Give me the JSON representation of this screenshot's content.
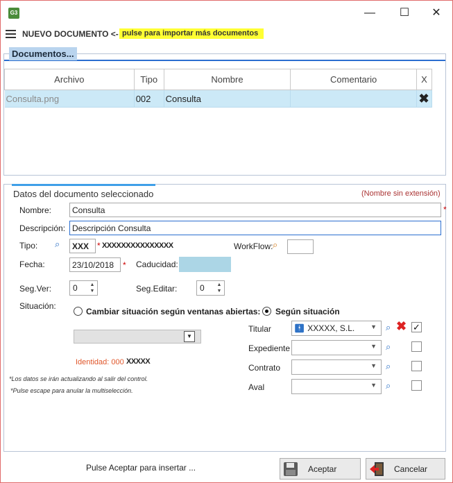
{
  "window": {
    "app_icon": "G3",
    "minimize_glyph": "—",
    "maximize_glyph": "☐",
    "close_glyph": "✕"
  },
  "header": {
    "title": "NUEVO DOCUMENTO <-",
    "hint": "pulse para importar más documentos"
  },
  "documents": {
    "group_title": "Documentos...",
    "columns": [
      "Archivo",
      "Tipo",
      "Nombre",
      "Comentario",
      "X"
    ],
    "rows": [
      {
        "archivo": "Consulta.png",
        "tipo": "002",
        "nombre": "Consulta",
        "comentario": "",
        "delete": "✖"
      }
    ]
  },
  "detail": {
    "section_title": "Datos del documento seleccionado",
    "section_note": "(Nombre sin extensión)",
    "nombre_label": "Nombre:",
    "nombre_value": "Consulta",
    "descripcion_label": "Descripción:",
    "descripcion_value": "Descripción Consulta",
    "tipo_label": "Tipo:",
    "tipo_code": "XXX",
    "tipo_desc": "XXXXXXXXXXXXXXX",
    "workflow_label": "WorkFlow:",
    "fecha_label": "Fecha:",
    "fecha_value": "23/10/2018",
    "caducidad_label": "Caducidad:",
    "segver_label": "Seg.Ver:",
    "segver_value": "0",
    "segeditar_label": "Seg.Editar:",
    "segeditar_value": "0",
    "situacion_label": "Situación:",
    "radio_cambiar": "Cambiar situación según ventanas abiertas:",
    "radio_segun": "Según situación",
    "identidad_label": "Identidad: 000",
    "identidad_value": "XXXXX",
    "titular_label": "Titular",
    "titular_value": "XXXXX, S.L.",
    "expediente_label": "Expediente",
    "contrato_label": "Contrato",
    "aval_label": "Aval",
    "required_mark": "*",
    "footnote1": "*Los datos se irán actualizando  al salir del control.",
    "footnote2": "*Pulse escape para anular la multiselección."
  },
  "footer": {
    "hint": "Pulse Aceptar para insertar ...",
    "accept_label": "Aceptar",
    "cancel_label": "Cancelar"
  },
  "colors": {
    "selected_row": "#cce9f7",
    "hint_highlight": "#ffff33",
    "required": "#cc0000",
    "identidad": "#e0562a"
  }
}
